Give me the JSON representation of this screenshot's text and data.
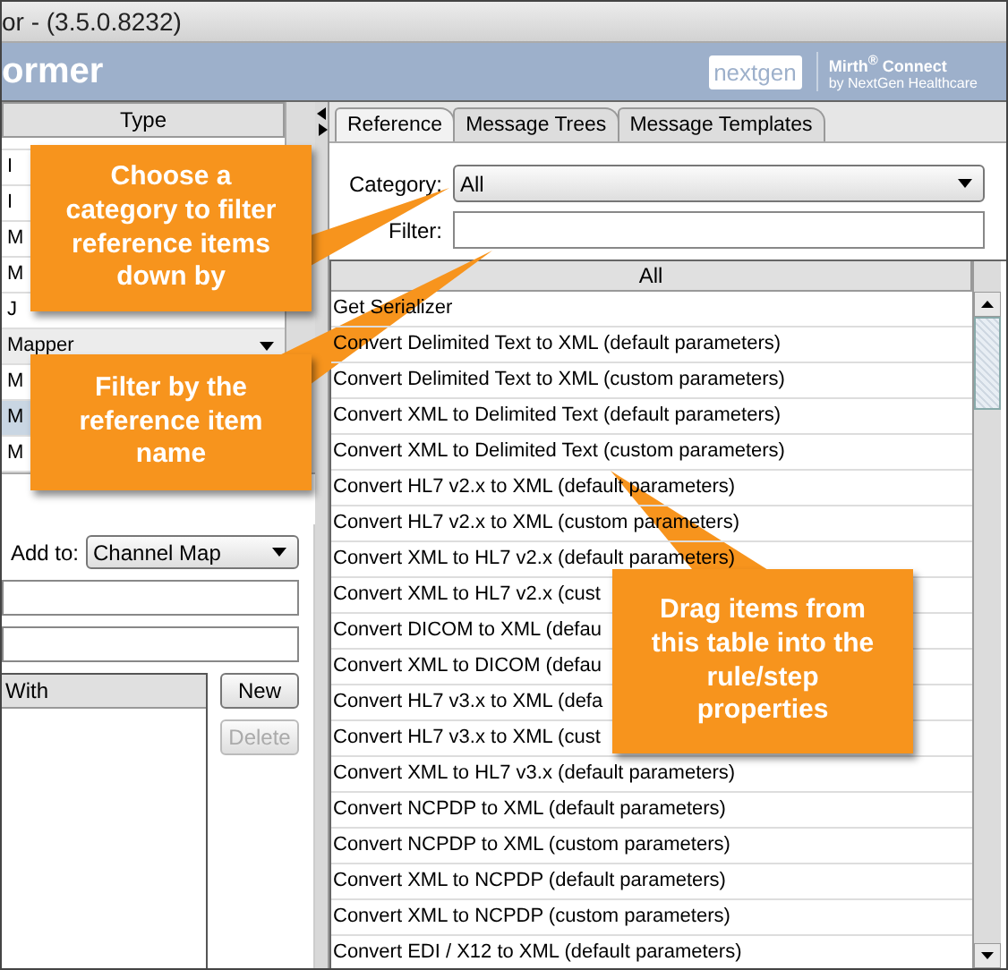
{
  "window": {
    "title": "or - (3.5.0.8232)"
  },
  "header": {
    "title": "ormer",
    "logo": "nextgen",
    "brand": "Mirth$^{®}$ Connect",
    "brand_sub": "by NextGen Healthcare"
  },
  "type_table": {
    "columns": [
      "Type"
    ],
    "rows": [
      {
        "kind": "text",
        "cell": "I",
        "selected": false
      },
      {
        "kind": "text",
        "cell": "I",
        "selected": false
      },
      {
        "kind": "text",
        "cell": "M",
        "selected": false
      },
      {
        "kind": "text",
        "cell": "M",
        "selected": false
      },
      {
        "kind": "text",
        "cell": "J",
        "selected": false
      },
      {
        "kind": "dropdown",
        "cell": "Mapper",
        "selected": false
      },
      {
        "kind": "text",
        "cell": "M",
        "selected": false
      },
      {
        "kind": "text",
        "cell": "M",
        "selected": true
      },
      {
        "kind": "text",
        "cell": "M",
        "selected": false
      }
    ]
  },
  "add_to": {
    "label": "Add to:",
    "value": "Channel Map"
  },
  "replace_table": {
    "columns": [
      "With"
    ]
  },
  "buttons": [
    {
      "label": "New",
      "disabled": false
    },
    {
      "label": "Delete",
      "disabled": true
    }
  ],
  "tabs": [
    {
      "label": "Reference",
      "selected": true
    },
    {
      "label": "Message Trees",
      "selected": false
    },
    {
      "label": "Message Templates",
      "selected": false
    }
  ],
  "category": {
    "label": "Category:",
    "value": "All"
  },
  "filter": {
    "label": "Filter:"
  },
  "reference_table": {
    "columns": [
      "All"
    ],
    "rows": [
      "Get Serializer",
      "Convert Delimited Text to XML (default parameters)",
      "Convert Delimited Text to XML (custom parameters)",
      "Convert XML to Delimited Text (default parameters)",
      "Convert XML to Delimited Text (custom parameters)",
      "Convert HL7 v2.x to XML (default parameters)",
      "Convert HL7 v2.x to XML (custom parameters)",
      "Convert XML to HL7 v2.x (default parameters)",
      "Convert XML to HL7 v2.x (cust",
      "Convert DICOM to XML (defau",
      "Convert XML to DICOM (defau",
      "Convert HL7 v3.x to XML (defa",
      "Convert HL7 v3.x to XML (cust",
      "Convert XML to HL7 v3.x (default parameters)",
      "Convert NCPDP to XML (default parameters)",
      "Convert NCPDP to XML (custom parameters)",
      "Convert XML to NCPDP (default parameters)",
      "Convert XML to NCPDP (custom parameters)",
      "Convert EDI / X12 to XML (default parameters)"
    ]
  },
  "callouts": [
    {
      "text": "Choose a category to filter reference items down by"
    },
    {
      "text": "Filter by the reference item name"
    },
    {
      "text": "Drag items from this table into the rule/step properties"
    }
  ]
}
